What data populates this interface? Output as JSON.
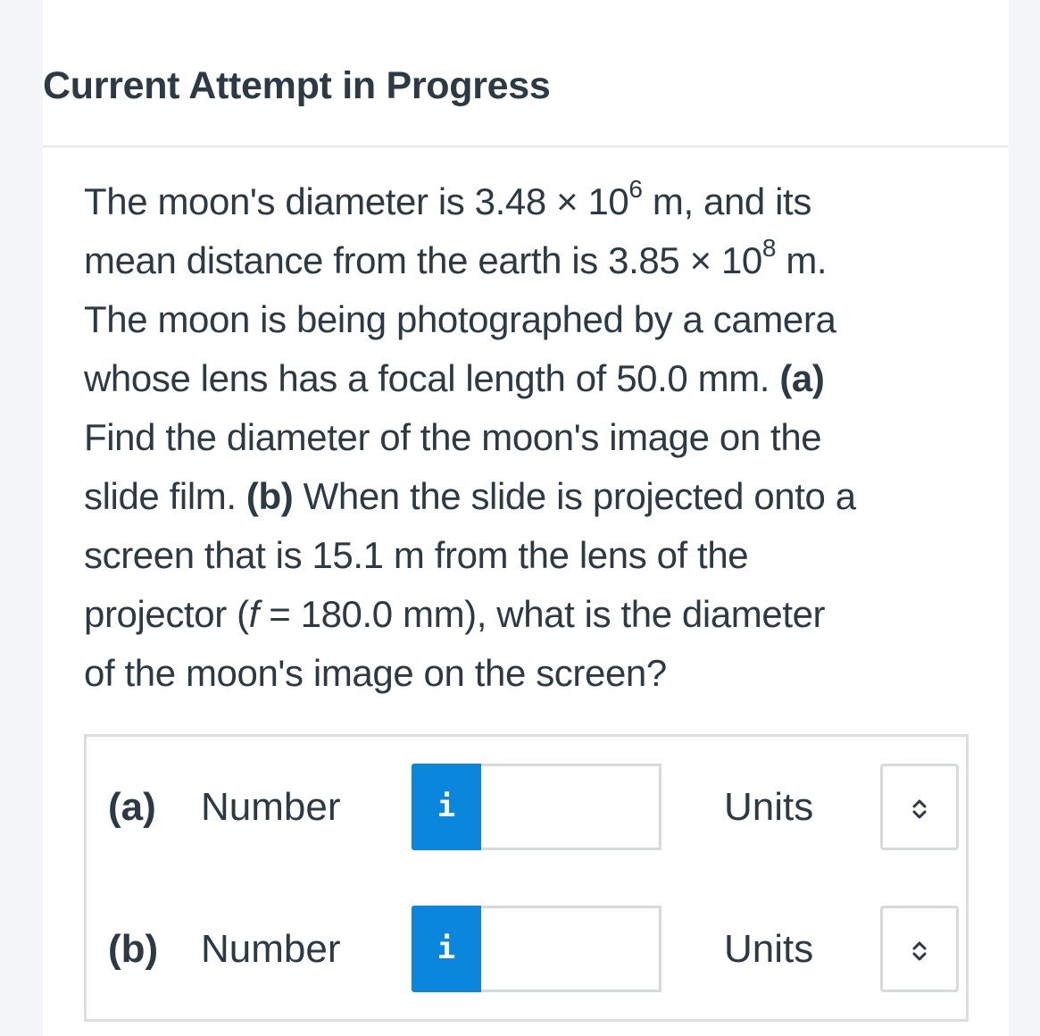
{
  "header": {
    "title": "Current Attempt in Progress"
  },
  "question": {
    "line1_pre": "The moon's diameter is 3.48 × 10",
    "line1_exp": "6",
    "line1_post": " m, and its",
    "line2_pre": "mean distance from the earth is 3.85 × 10",
    "line2_exp": "8",
    "line2_post": " m.",
    "line3": "The moon is being photographed by a camera",
    "line4_pre": "whose lens has a focal length of 50.0 mm. ",
    "line4_bold": "(a)",
    "line5": "Find the diameter of the moon's image on the",
    "line6_pre": "slide film. ",
    "line6_bold": "(b)",
    "line6_post": " When the slide is projected onto a",
    "line7": "screen that is 15.1 m from the lens of the",
    "line8_pre": "projector (",
    "line8_italic": "f",
    "line8_post": " = 180.0 mm), what is the diameter",
    "line9": "of the moon's image on the screen?"
  },
  "answers": [
    {
      "part": "(a)",
      "number_label": "Number",
      "info_icon": "i",
      "value": "",
      "units_label": "Units"
    },
    {
      "part": "(b)",
      "number_label": "Number",
      "info_icon": "i",
      "value": "",
      "units_label": "Units"
    }
  ],
  "colors": {
    "info_button": "#0a87dc",
    "text": "#2c3a45",
    "border": "#d7dadc"
  }
}
